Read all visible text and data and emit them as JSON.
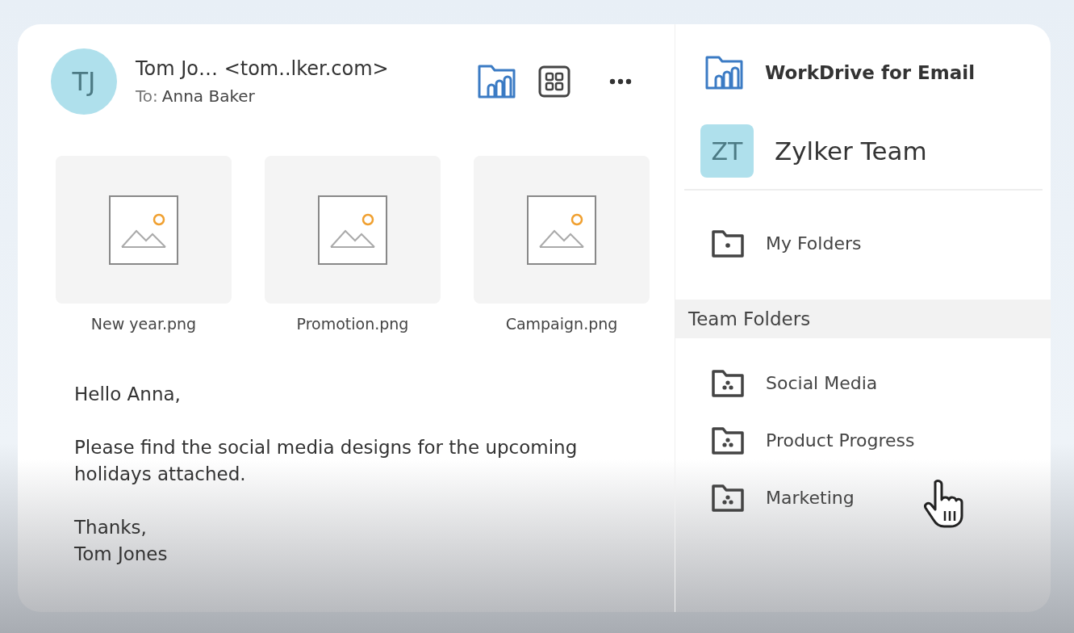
{
  "email": {
    "avatar": "TJ",
    "sender": "Tom Jo… <tom..lker.com>",
    "recipient_label": "To:",
    "recipient": "Anna Baker",
    "attachments": [
      {
        "name": "New year.png"
      },
      {
        "name": "Promotion.png"
      },
      {
        "name": "Campaign.png"
      }
    ],
    "body": [
      [
        "Hello Anna,"
      ],
      [
        "Please find the social media designs for the upcoming holidays attached."
      ],
      [
        "Thanks,",
        "Tom Jones"
      ]
    ]
  },
  "sidebar": {
    "title": "WorkDrive for Email",
    "team_avatar": "ZT",
    "team_name": "Zylker Team",
    "my_folders": "My Folders",
    "section": "Team Folders",
    "folders": [
      {
        "name": "Social Media"
      },
      {
        "name": "Product Progress"
      },
      {
        "name": "Marketing"
      }
    ]
  }
}
